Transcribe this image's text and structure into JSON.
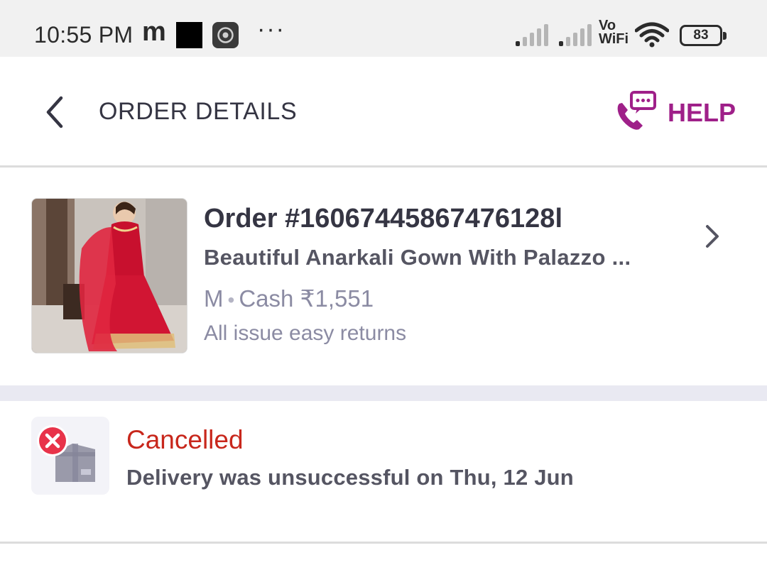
{
  "status_bar": {
    "time": "10:55 PM",
    "app_letter": "m",
    "network_label_top": "Vo",
    "network_label_bottom": "WiFi",
    "battery": "83"
  },
  "header": {
    "title": "ORDER DETAILS",
    "help_label": "HELP",
    "accent_color": "#9f2089"
  },
  "order": {
    "number": "Order #16067445867476128l",
    "product_name": "Beautiful Anarkali Gown With Palazzo ...",
    "size": "M",
    "payment": "Cash ₹1,551",
    "returns": "All issue easy returns"
  },
  "status": {
    "title": "Cancelled",
    "description": "Delivery was unsuccessful on Thu, 12 Jun",
    "status_color": "#c8271c"
  }
}
